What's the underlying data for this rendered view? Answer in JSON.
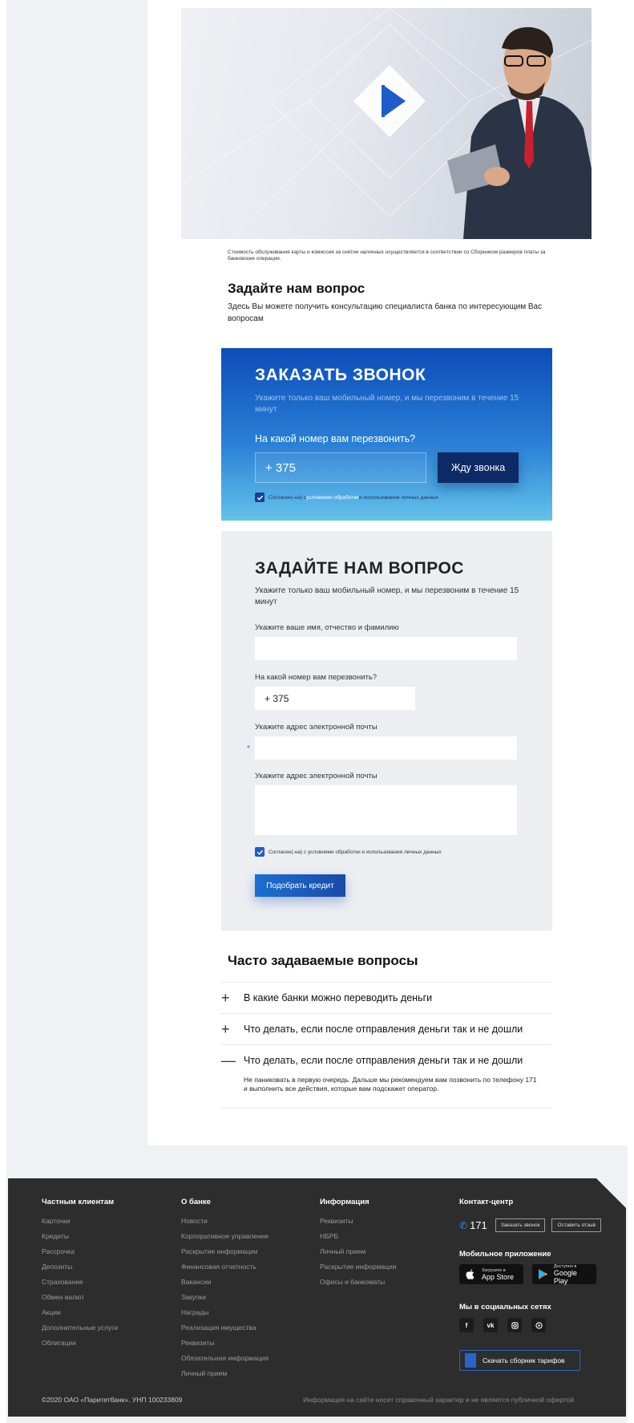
{
  "hero": {
    "note": "Стоимость обслуживания карты и комиссия за снятие наличных осуществляется в соответствии со Сборником размеров платы за банковские операции."
  },
  "ask_section": {
    "title": "Задайте нам вопрос",
    "description": "Здесь Вы можете получить консультацию специалиста банка по интересующим Вас вопросам"
  },
  "callback": {
    "title": "ЗАКАЗАТЬ ЗВОНОК",
    "subtitle": "Укажите только ваш мобильный номер, и мы перезвоним в течение 15 минут",
    "phone_label": "На какой номер вам перезвонить?",
    "phone_value": "+ 375",
    "submit": "Жду звонка",
    "agree_prefix": "Согласен(-на) с ",
    "agree_link": "условиями обработки",
    "agree_suffix": " и использования личных данных",
    "checked": true
  },
  "question_form": {
    "title": "ЗАДАЙТЕ НАМ ВОПРОС",
    "subtitle": "Укажите только ваш мобильный номер, и мы перезвоним в течение 15 минут",
    "name_label": "Укажите ваше имя, отчество и фамилию",
    "name_value": "",
    "phone_label": "На какой номер вам перезвонить?",
    "phone_value": "+ 375",
    "email_label": "Укажите адрес электронной почты",
    "email_value": "",
    "message_label": "Укажите адрес электронной почты",
    "message_value": "",
    "asterisk": "*",
    "agree": "Согласен(-на) с условиями обработки и использования личных данных",
    "checked": true,
    "submit": "Подобрать кредит"
  },
  "faq": {
    "title": "Часто задаваемые вопросы",
    "items": [
      {
        "sign": "+",
        "question": "В какие банки можно переводить деньги",
        "answer": ""
      },
      {
        "sign": "+",
        "question": "Что делать, если после отправления деньги так и не дошли",
        "answer": ""
      },
      {
        "sign": "—",
        "question": "Что делать, если после отправления деньги так и не дошли",
        "answer": "Не паниковать в первую очередь. Дальше мы рекомендуем вам позвонить по телефону 171 и выполнить все действия, которые вам подскажет оператор."
      }
    ]
  },
  "footer": {
    "columns": [
      {
        "title": "Частным клиентам",
        "links": [
          "Карточки",
          "Кредиты",
          "Рассрочка",
          "Депозиты",
          "Страхование",
          "Обмен валют",
          "Акции",
          "Дополнительные услуги",
          "Облигации"
        ]
      },
      {
        "title": "О банке",
        "links": [
          "Новости",
          "Корпоративное управление",
          "Раскрытие информации",
          "Финансовая отчетность",
          "Вакансии",
          "Закупки",
          "Награды",
          "Реализация имущества",
          "Реквизиты",
          "Обязательная информация",
          "Личный прием"
        ]
      },
      {
        "title": "Информация",
        "links": [
          "Реквизиты",
          "НБРБ",
          "Личный прием",
          "Раскрытие информации",
          "Офисы и банкоматы"
        ]
      }
    ],
    "contact_title": "Контакт-центр",
    "phone": "171",
    "order_call": "Заказать звонок",
    "feedback": "Оставить отзыв",
    "mobile_title": "Мобильное приложение",
    "app_store_top": "Загрузите в",
    "app_store": "App Store",
    "google_play_top": "Доступно в",
    "google_play": "Google Play",
    "social_title": "Мы в социальных сетях",
    "socials": [
      "f",
      "vk",
      "ig",
      "yt"
    ],
    "tariff_button": "Скачать сборник тарифов",
    "copyright": "©2020 ОАО «Паритетбанк». УНП 100233809",
    "disclaimer": "Информация на сайте носит справочный характер и не является публичной офертой"
  },
  "colors": {
    "callback_top": "#0c4db8",
    "callback_bottom": "#64c2ea",
    "dark_button": "#0d2a66",
    "footer_bg": "#2d2d2d",
    "accent": "#1f5fc5"
  }
}
